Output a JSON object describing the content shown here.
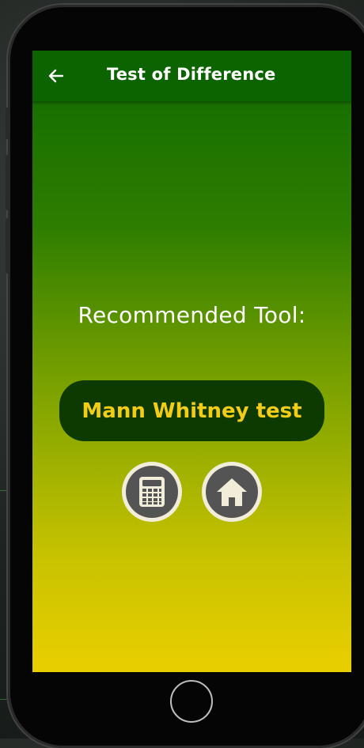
{
  "appbar": {
    "title": "Test of Difference",
    "back_icon": "arrow-left-icon"
  },
  "main": {
    "label": "Recommended Tool:",
    "result": "Mann Whitney test",
    "actions": [
      {
        "name": "calculator-button",
        "icon": "calculator-icon"
      },
      {
        "name": "home-button",
        "icon": "home-icon"
      }
    ]
  },
  "colors": {
    "appbar": "#0b6400",
    "gradient_top": "#0f6a00",
    "gradient_bottom": "#e9cf00",
    "pill_bg": "#0d3a00",
    "result_text": "#f3cc16"
  }
}
